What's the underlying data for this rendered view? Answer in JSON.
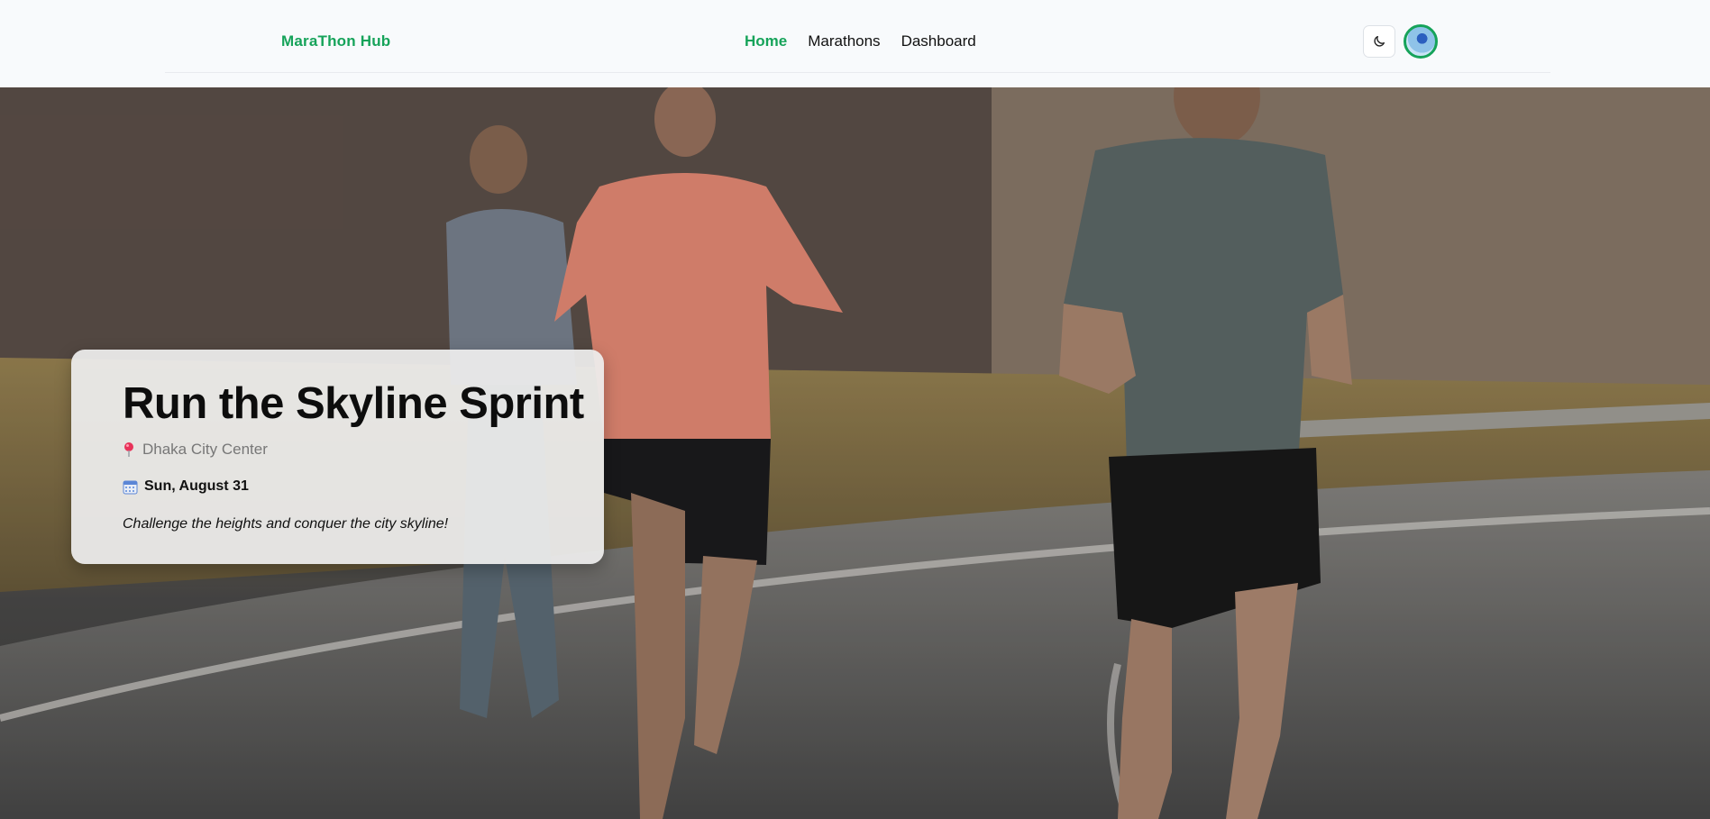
{
  "header": {
    "brand": "MaraThon Hub",
    "nav": [
      {
        "label": "Home",
        "active": true
      },
      {
        "label": "Marathons",
        "active": false
      },
      {
        "label": "Dashboard",
        "active": false
      }
    ],
    "theme_toggle_icon": "moon-icon",
    "avatar_icon": "user-avatar"
  },
  "hero": {
    "image": "runners-on-road",
    "card": {
      "title": "Run the Skyline Sprint",
      "location_icon": "pin-icon",
      "location": "Dhaka City Center",
      "date_icon": "calendar-icon",
      "date": "Sun, August 31",
      "tagline": "Challenge the heights and conquer the city skyline!"
    }
  },
  "colors": {
    "accent": "#16a35a",
    "corner_badge": "#34d6bd"
  }
}
